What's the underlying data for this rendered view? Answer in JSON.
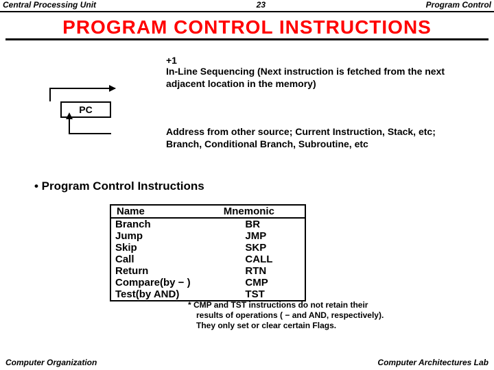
{
  "header": {
    "left": "Central Processing Unit",
    "center": "23",
    "right": "Program Control"
  },
  "title": "PROGRAM  CONTROL  INSTRUCTIONS",
  "plusone": "+1",
  "inline_text": "In-Line Sequencing (Next instruction is fetched from the next adjacent location in the memory)",
  "pc_label": "PC",
  "addr_text": "Address from other source; Current Instruction, Stack, etc; Branch, Conditional Branch, Subroutine, etc",
  "bullet": "• Program Control Instructions",
  "table": {
    "headers": [
      "Name",
      "Mnemonic"
    ],
    "rows": [
      [
        "Branch",
        "BR"
      ],
      [
        "Jump",
        "JMP"
      ],
      [
        "Skip",
        "SKP"
      ],
      [
        "Call",
        "CALL"
      ],
      [
        "Return",
        "RTN"
      ],
      [
        "Compare(by − )",
        "CMP"
      ],
      [
        "Test(by AND)",
        "TST"
      ]
    ]
  },
  "footnote": {
    "l1": "* CMP and TST instructions do not retain their",
    "l2": "results of operations ( − and AND, respectively).",
    "l3": "They only set or clear certain Flags."
  },
  "footer": {
    "left": "Computer Organization",
    "right": "Computer Architectures Lab"
  }
}
